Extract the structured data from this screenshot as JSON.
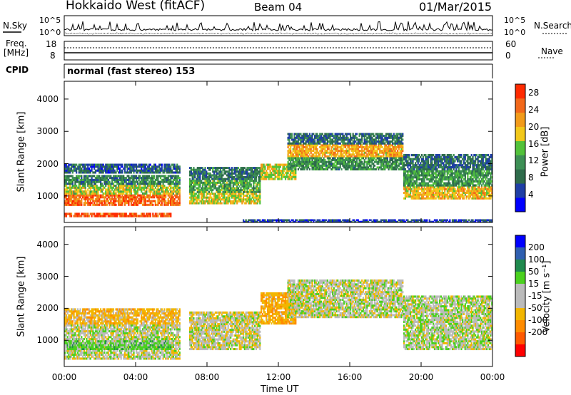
{
  "header": {
    "title": "Hokkaido West (fitACF)",
    "beam": "Beam 04",
    "date": "01/Mar/2015"
  },
  "noise_panel": {
    "left_label": "N.Sky",
    "right_label": "N.Search",
    "left_ticks": [
      "10^5",
      "10^0"
    ],
    "right_ticks": [
      "10^5",
      "10^0"
    ]
  },
  "freq_panel": {
    "label_line1": "Freq.",
    "label_line2": "[MHz]",
    "left_ticks": [
      "18",
      "8"
    ],
    "right_ticks": [
      "60",
      "0"
    ],
    "right_label": "Nave"
  },
  "cpid": {
    "label": "CPID",
    "text": "normal (fast stereo) 153"
  },
  "colors": {
    "power": [
      "#0000ff",
      "#1f3fa6",
      "#2e6b4b",
      "#3d8f55",
      "#52c23a",
      "#f2c81a",
      "#f29b1a",
      "#f2681a",
      "#ff2a00"
    ],
    "velocity": [
      "#ff0000",
      "#ff5a00",
      "#ff8c00",
      "#f2b600",
      "#bbbbbb",
      "#bbbbbb",
      "#4ad11e",
      "#1f8a4e",
      "#2f5fb0",
      "#0000ff"
    ]
  },
  "chart_data": [
    {
      "type": "heatmap",
      "title": "Power",
      "ylabel": "Slant Range [km]",
      "xlabel": "",
      "ylim": [
        180,
        4550
      ],
      "yticks": [
        1000,
        2000,
        3000,
        4000
      ],
      "x_ticks": [
        "00:00",
        "04:00",
        "08:00",
        "12:00",
        "16:00",
        "20:00",
        "00:00"
      ],
      "x_ticks_hours": [
        0,
        4,
        8,
        12,
        16,
        20,
        24
      ],
      "colorbar": {
        "label": "Power [dB]",
        "ticks": [
          "4",
          "8",
          "12",
          "16",
          "20",
          "24",
          "28"
        ],
        "tick_values": [
          4,
          8,
          12,
          16,
          20,
          24,
          28
        ],
        "range": [
          0,
          30
        ]
      },
      "bands": [
        {
          "t0": 0,
          "t1": 6.5,
          "r0": 700,
          "r1": 1050,
          "value": 25
        },
        {
          "t0": 0,
          "t1": 6.5,
          "r0": 1050,
          "r1": 1350,
          "value": 17
        },
        {
          "t0": 0,
          "t1": 6.5,
          "r0": 1350,
          "r1": 1650,
          "value": 10
        },
        {
          "t0": 0,
          "t1": 6.5,
          "r0": 1700,
          "r1": 2000,
          "value": 7
        },
        {
          "t0": 0,
          "t1": 6,
          "r0": 350,
          "r1": 480,
          "value": 27
        },
        {
          "t0": 7,
          "t1": 11,
          "r0": 750,
          "r1": 1100,
          "value": 18
        },
        {
          "t0": 7,
          "t1": 11,
          "r0": 1100,
          "r1": 1500,
          "value": 13
        },
        {
          "t0": 7,
          "t1": 11,
          "r0": 1500,
          "r1": 1900,
          "value": 9
        },
        {
          "t0": 11,
          "t1": 13,
          "r0": 1500,
          "r1": 2000,
          "value": 18
        },
        {
          "t0": 12.5,
          "t1": 19,
          "r0": 2200,
          "r1": 2600,
          "value": 21
        },
        {
          "t0": 12.5,
          "t1": 19,
          "r0": 1800,
          "r1": 2200,
          "value": 11
        },
        {
          "t0": 12.5,
          "t1": 19,
          "r0": 2600,
          "r1": 2950,
          "value": 8
        },
        {
          "t0": 19,
          "t1": 24,
          "r0": 900,
          "r1": 1300,
          "value": 20
        },
        {
          "t0": 19,
          "t1": 24,
          "r0": 1300,
          "r1": 1800,
          "value": 12
        },
        {
          "t0": 19,
          "t1": 24,
          "r0": 1800,
          "r1": 2300,
          "value": 8
        },
        {
          "t0": 10,
          "t1": 24,
          "r0": 180,
          "r1": 280,
          "value": 5
        }
      ]
    },
    {
      "type": "heatmap",
      "title": "Velocity",
      "ylabel": "Slant Range [km]",
      "xlabel": "Time UT",
      "ylim": [
        180,
        4550
      ],
      "yticks": [
        1000,
        2000,
        3000,
        4000
      ],
      "x_ticks": [
        "00:00",
        "04:00",
        "08:00",
        "12:00",
        "16:00",
        "20:00",
        "00:00"
      ],
      "x_ticks_hours": [
        0,
        4,
        8,
        12,
        16,
        20,
        24
      ],
      "colorbar": {
        "label": "Velocity [m s⁻¹]",
        "ticks": [
          "200",
          "100",
          "50",
          "15",
          "-15",
          "-50",
          "-100",
          "-200"
        ]
      },
      "bands": [
        {
          "t0": 0,
          "t1": 6.5,
          "r0": 400,
          "r1": 1500,
          "value": 0
        },
        {
          "t0": 0,
          "t1": 6.5,
          "r0": 1500,
          "r1": 2000,
          "value": -30
        },
        {
          "t0": 7,
          "t1": 11,
          "r0": 700,
          "r1": 1900,
          "value": -5
        },
        {
          "t0": 11,
          "t1": 13,
          "r0": 1500,
          "r1": 2500,
          "value": -40
        },
        {
          "t0": 12.5,
          "t1": 19,
          "r0": 1700,
          "r1": 2900,
          "value": 0
        },
        {
          "t0": 19,
          "t1": 24,
          "r0": 700,
          "r1": 2400,
          "value": 5
        },
        {
          "t0": 0,
          "t1": 6,
          "r0": 700,
          "r1": 1000,
          "value": 30
        }
      ]
    }
  ]
}
